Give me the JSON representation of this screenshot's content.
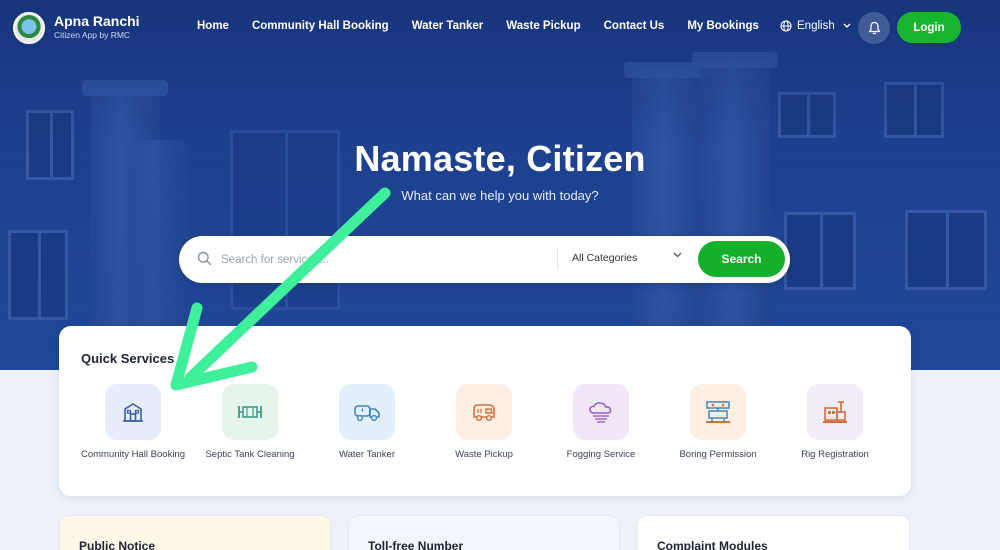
{
  "brand": {
    "name": "Apna Ranchi",
    "subtitle": "Citizen App by RMC",
    "logo_icon": "rmc-emblem-icon"
  },
  "nav": {
    "links": [
      {
        "label": "Home"
      },
      {
        "label": "Community Hall Booking"
      },
      {
        "label": "Water Tanker"
      },
      {
        "label": "Waste Pickup"
      },
      {
        "label": "Contact Us"
      },
      {
        "label": "My Bookings"
      }
    ],
    "language": "English",
    "notification_icon": "bell-icon",
    "login_label": "Login"
  },
  "hero": {
    "title": "Namaste, Citizen",
    "subtitle": "What can we help you with today?"
  },
  "search": {
    "placeholder": "Search for services...",
    "category": "All Categories",
    "button_label": "Search"
  },
  "quick_services": {
    "title": "Quick Services",
    "items": [
      {
        "label": "Community Hall Booking",
        "icon": "building-icon",
        "bg": "#e6eefb",
        "color": "#3a5fa8"
      },
      {
        "label": "Septic Tank Cleaning",
        "icon": "tank-icon",
        "bg": "#e5f5ec",
        "color": "#3f9a8a"
      },
      {
        "label": "Water Tanker",
        "icon": "water-truck-icon",
        "bg": "#e3f0fb",
        "color": "#3f86c8"
      },
      {
        "label": "Waste Pickup",
        "icon": "garbage-truck-icon",
        "bg": "#fdeee4",
        "color": "#d2703a"
      },
      {
        "label": "Fogging Service",
        "icon": "fog-cloud-icon",
        "bg": "#f1e7f8",
        "color": "#9a5fc2"
      },
      {
        "label": "Boring Permission",
        "icon": "drill-rig-icon",
        "bg": "#fdeee4",
        "color": "#3f86c8"
      },
      {
        "label": "Rig Registration",
        "icon": "rig-machine-icon",
        "bg": "#f2ecf8",
        "color": "#d2703a"
      }
    ]
  },
  "bottom_cards": [
    {
      "title": "Public Notice",
      "bg": "#fff8e6"
    },
    {
      "title": "Toll-free Number",
      "bg": "#f2f6fd"
    },
    {
      "title": "Complaint Modules",
      "bg": "#ffffff"
    }
  ],
  "colors": {
    "primary_blue": "#1f4597",
    "accent_green": "#14b02a",
    "annotation_arrow": "#3ef09a"
  }
}
